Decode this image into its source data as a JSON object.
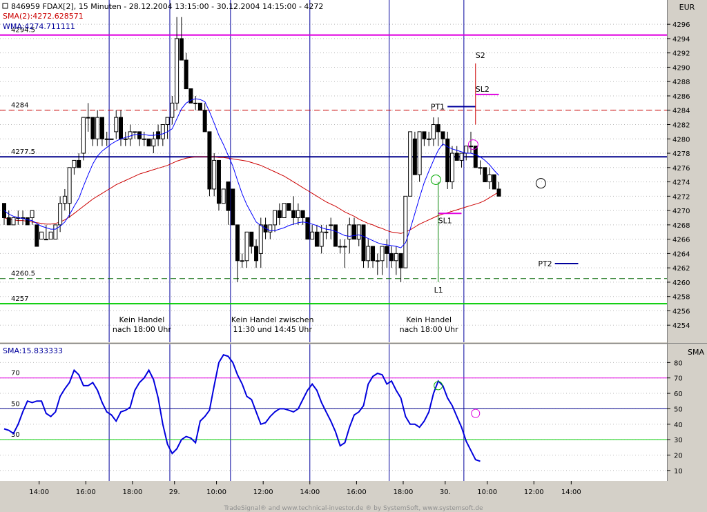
{
  "header": {
    "title": "846959  FDAX[2], 15 Minuten - 28.12.2004 13:15:00 - 30.12.2004 14:15:00 - 4272",
    "sma_label": "SMA(2):4272.628571",
    "wma_label": "WMA:4274.711111",
    "currency": "EUR"
  },
  "lower_panel": {
    "title": "SMA:15.833333",
    "axis_label": "SMA"
  },
  "footer": {
    "credit": "TradeSignal® and www.technical-investor.de ® by SystemSoft, www.systemsoft.de"
  },
  "colors": {
    "candle_up": "#ffffff",
    "candle_down": "#000000",
    "wma": "#0000ff",
    "sma": "#cc0000",
    "magenta": "#e000e0",
    "blue_level": "#00008b",
    "green_level": "#00cc00",
    "vline": "#00009c"
  },
  "chart_data": [
    {
      "type": "candlestick",
      "ylim": [
        4252,
        4299
      ],
      "y_ticks": [
        4254,
        4256,
        4258,
        4260,
        4262,
        4264,
        4266,
        4268,
        4270,
        4272,
        4274,
        4276,
        4278,
        4280,
        4282,
        4284,
        4286,
        4288,
        4290,
        4292,
        4294,
        4296
      ],
      "x_tick_labels": [
        "14:00",
        "16:00",
        "18:00",
        "29.",
        "10:00",
        "12:00",
        "14:00",
        "16:00",
        "18:00",
        "30.",
        "10:00",
        "12:00",
        "14:00"
      ],
      "candles": [
        [
          4271,
          4271,
          4268,
          4269
        ],
        [
          4269,
          4270,
          4268,
          4268
        ],
        [
          4268,
          4269,
          4268,
          4269
        ],
        [
          4269,
          4270,
          4268,
          4269
        ],
        [
          4269,
          4270,
          4268,
          4269
        ],
        [
          4269,
          4269,
          4268,
          4268
        ],
        [
          4269,
          4270,
          4268,
          4270
        ],
        [
          4268,
          4268,
          4265,
          4265
        ],
        [
          4266,
          4267,
          4266,
          4267
        ],
        [
          4266,
          4268,
          4266,
          4266
        ],
        [
          4266,
          4267,
          4266,
          4267
        ],
        [
          4266,
          4268,
          4266,
          4268
        ],
        [
          4268,
          4272,
          4267,
          4271
        ],
        [
          4271,
          4273,
          4270,
          4272
        ],
        [
          4271,
          4274,
          4269,
          4276
        ],
        [
          4276,
          4276,
          4275,
          4277
        ],
        [
          4277,
          4278,
          4276,
          4276
        ],
        [
          4278,
          4283,
          4277,
          4283
        ],
        [
          4283,
          4285,
          4281,
          4283
        ],
        [
          4283,
          4283,
          4279,
          4280
        ],
        [
          4280,
          4284,
          4279,
          4283
        ],
        [
          4283,
          4283,
          4279,
          4280
        ],
        [
          4280,
          4281,
          4279,
          4280
        ],
        [
          4280,
          4280,
          4280,
          4280
        ],
        [
          4281,
          4284,
          4280,
          4283
        ],
        [
          4283,
          4284,
          4279,
          4280
        ],
        [
          4280,
          4281,
          4279,
          4280
        ],
        [
          4280,
          4282,
          4279,
          4281
        ],
        [
          4281,
          4281,
          4280,
          4281
        ],
        [
          4281,
          4281,
          4279,
          4280
        ],
        [
          4280,
          4281,
          4279,
          4280
        ],
        [
          4280,
          4280,
          4279,
          4279
        ],
        [
          4279,
          4281,
          4278,
          4280
        ],
        [
          4281,
          4282,
          4279,
          4280
        ],
        [
          4280,
          4282,
          4279,
          4282
        ],
        [
          4282,
          4283,
          4280,
          4283
        ],
        [
          4283,
          4286,
          4282,
          4285
        ],
        [
          4285,
          4297,
          4284,
          4294
        ],
        [
          4294,
          4297,
          4291,
          4291
        ],
        [
          4291,
          4292,
          4287,
          4287
        ],
        [
          4287,
          4287,
          4285,
          4285
        ],
        [
          4285,
          4286,
          4284,
          4285
        ],
        [
          4285,
          4285,
          4284,
          4284
        ],
        [
          4284,
          4285,
          4281,
          4281
        ],
        [
          4281,
          4281,
          4272,
          4273
        ],
        [
          4273,
          4278,
          4272,
          4277
        ],
        [
          4277,
          4277,
          4270,
          4271
        ],
        [
          4271,
          4273,
          4271,
          4273
        ],
        [
          4274,
          4274,
          4268,
          4270
        ],
        [
          4273,
          4273,
          4268,
          4268
        ],
        [
          4268,
          4268,
          4260,
          4263
        ],
        [
          4263,
          4264,
          4262,
          4263
        ],
        [
          4263,
          4267,
          4262,
          4267
        ],
        [
          4267,
          4267,
          4264,
          4265
        ],
        [
          4265,
          4266,
          4262,
          4263
        ],
        [
          4264,
          4269,
          4262,
          4268
        ],
        [
          4268,
          4269,
          4266,
          4267
        ],
        [
          4267,
          4268,
          4266,
          4268
        ],
        [
          4268,
          4270,
          4267,
          4270
        ],
        [
          4270,
          4271,
          4268,
          4269
        ],
        [
          4269,
          4271,
          4269,
          4271
        ],
        [
          4271,
          4271,
          4270,
          4270
        ],
        [
          4270,
          4272,
          4268,
          4269
        ],
        [
          4269,
          4271,
          4268,
          4270
        ],
        [
          4270,
          4270,
          4268,
          4269
        ],
        [
          4269,
          4269,
          4266,
          4266
        ],
        [
          4266,
          4268,
          4266,
          4267
        ],
        [
          4267,
          4268,
          4265,
          4265
        ],
        [
          4265,
          4268,
          4264,
          4267
        ],
        [
          4267,
          4268,
          4266,
          4267
        ],
        [
          4268,
          4269,
          4266,
          4268
        ],
        [
          4268,
          4268,
          4265,
          4265
        ],
        [
          4265,
          4266,
          4264,
          4265
        ],
        [
          4265,
          4266,
          4262,
          4265
        ],
        [
          4266,
          4269,
          4264,
          4268
        ],
        [
          4268,
          4269,
          4266,
          4266
        ],
        [
          4266,
          4268,
          4265,
          4268
        ],
        [
          4268,
          4268,
          4262,
          4263
        ],
        [
          4263,
          4266,
          4262,
          4265
        ],
        [
          4265,
          4265,
          4262,
          4263
        ],
        [
          4263,
          4264,
          4261,
          4263
        ],
        [
          4263,
          4265,
          4261,
          4265
        ],
        [
          4265,
          4266,
          4262,
          4264
        ],
        [
          4264,
          4265,
          4262,
          4263
        ],
        [
          4263,
          4265,
          4261,
          4264
        ],
        [
          4264,
          4264,
          4260,
          4262
        ],
        [
          4262,
          4272,
          4262,
          4272
        ],
        [
          4272,
          4281,
          4272,
          4281
        ],
        [
          4280,
          4281,
          4275,
          4275
        ],
        [
          4275,
          4281,
          4274,
          4281
        ],
        [
          4281,
          4281,
          4279,
          4280
        ],
        [
          4280,
          4281,
          4279,
          4280
        ],
        [
          4280,
          4283,
          4279,
          4282
        ],
        [
          4282,
          4283,
          4279,
          4281
        ],
        [
          4281,
          4281,
          4279,
          4280
        ],
        [
          4280,
          4281,
          4273,
          4274
        ],
        [
          4274,
          4279,
          4273,
          4278
        ],
        [
          4278,
          4279,
          4277,
          4277
        ],
        [
          4277,
          4278,
          4276,
          4278
        ],
        [
          4278,
          4279,
          4277,
          4279
        ],
        [
          4279,
          4281,
          4278,
          4279
        ],
        [
          4279,
          4279,
          4276,
          4276
        ],
        [
          4276,
          4277,
          4275,
          4276
        ],
        [
          4276,
          4276,
          4274,
          4274
        ],
        [
          4274,
          4276,
          4273,
          4275
        ],
        [
          4275,
          4275,
          4273,
          4273
        ],
        [
          4273,
          4274,
          4272,
          4272
        ]
      ],
      "wma": [
        4270,
        4269.5,
        4269.2,
        4269,
        4268.9,
        4268.7,
        4268.6,
        4268.2,
        4267.8,
        4267.6,
        4267.4,
        4267.4,
        4267.8,
        4268.4,
        4269.4,
        4270.6,
        4271.7,
        4273.4,
        4275,
        4276.5,
        4277.6,
        4278.3,
        4278.8,
        4279.3,
        4279.7,
        4280,
        4280.2,
        4280.4,
        4280.6,
        4280.6,
        4280.6,
        4280.5,
        4280.5,
        4280.6,
        4280.7,
        4281,
        4281.4,
        4282.8,
        4284.2,
        4285,
        4285.4,
        4285.6,
        4285.5,
        4285.2,
        4283.8,
        4282.2,
        4280.5,
        4279.2,
        4277.7,
        4276.2,
        4274.2,
        4272.3,
        4270.8,
        4269.6,
        4268.4,
        4267.9,
        4267.5,
        4267.2,
        4267.2,
        4267.4,
        4267.6,
        4267.9,
        4268.1,
        4268.3,
        4268.4,
        4268.3,
        4268.1,
        4267.9,
        4267.6,
        4267.4,
        4267.3,
        4267.1,
        4266.8,
        4266.5,
        4266.4,
        4266.5,
        4266.6,
        4266.4,
        4266.1,
        4265.8,
        4265.5,
        4265.3,
        4265.2,
        4265.1,
        4265,
        4264.8,
        4265.5,
        4267.4,
        4269.6,
        4271.8,
        4273.9,
        4275.5,
        4277,
        4278.4,
        4279.3,
        4278.9,
        4278.6,
        4278.4,
        4278.2,
        4278,
        4278,
        4277.8,
        4277.5,
        4277,
        4276.4,
        4275.6,
        4274.9
      ],
      "sma": [
        4269,
        4268.8,
        4268.7,
        4268.6,
        4268.6,
        4268.5,
        4268.4,
        4268.3,
        4268.2,
        4268.1,
        4268.1,
        4268.2,
        4268.4,
        4268.7,
        4269.1,
        4269.6,
        4270.1,
        4270.6,
        4271.1,
        4271.6,
        4272,
        4272.4,
        4272.8,
        4273.2,
        4273.6,
        4273.9,
        4274.2,
        4274.5,
        4274.8,
        4275.1,
        4275.3,
        4275.5,
        4275.7,
        4275.9,
        4276.1,
        4276.3,
        4276.6,
        4276.9,
        4277.1,
        4277.3,
        4277.4,
        4277.5,
        4277.5,
        4277.5,
        4277.5,
        4277.5,
        4277.4,
        4277.4,
        4277.3,
        4277.2,
        4277.1,
        4277,
        4276.9,
        4276.7,
        4276.5,
        4276.3,
        4276,
        4275.7,
        4275.4,
        4275.1,
        4274.8,
        4274.4,
        4274,
        4273.6,
        4273.2,
        4272.8,
        4272.4,
        4272,
        4271.6,
        4271.2,
        4270.9,
        4270.6,
        4270.2,
        4269.8,
        4269.5,
        4269.2,
        4268.8,
        4268.5,
        4268.2,
        4268,
        4267.7,
        4267.5,
        4267.2,
        4267,
        4266.9,
        4266.8,
        4267,
        4267.3,
        4267.7,
        4268.1,
        4268.4,
        4268.7,
        4269,
        4269.3,
        4269.5,
        4269.7,
        4269.9,
        4270.1,
        4270.3,
        4270.5,
        4270.7,
        4270.9,
        4271.1,
        4271.4,
        4271.8,
        4272.2,
        4272.6
      ],
      "levels": [
        {
          "label": "4294.5",
          "value": 4294.5,
          "color": "#e000e0",
          "style": "solid"
        },
        {
          "label": "4284",
          "value": 4284,
          "color": "#cc0000",
          "style": "dashed"
        },
        {
          "label": "4277.5",
          "value": 4277.5,
          "color": "#00008b",
          "style": "solid"
        },
        {
          "label": "4260.5",
          "value": 4260.5,
          "color": "#006600",
          "style": "dashed"
        },
        {
          "label": "4257",
          "value": 4257,
          "color": "#00cc00",
          "style": "solid"
        }
      ],
      "session_lines": [
        23,
        36,
        49,
        66,
        83,
        99
      ],
      "annotations": [
        {
          "text": "Kein Handel",
          "text2": "nach 18:00 Uhr",
          "index": 29.5
        },
        {
          "text": "Kein Handel zwischen",
          "text2": "11:30 und 14:45 Uhr",
          "index": 57.5
        },
        {
          "text": "Kein Handel",
          "text2": "nach 18:00 Uhr",
          "index": 91
        }
      ],
      "trade_marks": [
        {
          "label": "PT1",
          "value": 4284.5,
          "x_from": 95,
          "x_to": 101,
          "color": "#00009c",
          "label_at": "left"
        },
        {
          "label": "S2",
          "value": 4291.5,
          "index": 101,
          "color": "#cc0000"
        },
        {
          "label": "SL2",
          "value": 4286.2,
          "x_from": 101,
          "x_to": 106,
          "color": "#e000e0",
          "label_at": "top"
        },
        {
          "label": "SL1",
          "value": 4269.6,
          "x_from": 93,
          "x_to": 98,
          "color": "#e000e0",
          "label_at": "below"
        },
        {
          "label": "L1",
          "value": 4260,
          "index": 93,
          "color": "#008000"
        },
        {
          "label": "PT2",
          "value": 4262.6,
          "x_from": 118,
          "x_to": 123,
          "color": "#00009c",
          "label_at": "left"
        }
      ],
      "circles": [
        {
          "index": 92.5,
          "value": 4274.3,
          "color": "#00aa00"
        },
        {
          "index": 100.5,
          "value": 4279.2,
          "color": "#e000e0"
        },
        {
          "index": 115,
          "value": 4273.8,
          "color": "#000000"
        }
      ]
    },
    {
      "type": "line",
      "name": "SMA",
      "ylim": [
        5,
        90
      ],
      "y_ticks": [
        10,
        20,
        30,
        40,
        50,
        60,
        70,
        80
      ],
      "levels": [
        {
          "label": "70",
          "value": 70,
          "color": "#e000e0"
        },
        {
          "label": "50",
          "value": 50,
          "color": "#00008b"
        },
        {
          "label": "30",
          "value": 30,
          "color": "#00cc00"
        }
      ],
      "values": [
        37,
        36,
        34,
        40,
        48,
        55,
        54,
        55,
        55,
        47,
        45,
        48,
        58,
        63,
        67,
        75,
        72,
        65,
        65,
        67,
        62,
        54,
        48,
        46,
        42,
        48,
        49,
        51,
        62,
        67,
        70,
        75,
        69,
        57,
        40,
        27,
        21,
        24,
        30,
        32,
        31,
        28,
        42,
        45,
        49,
        65,
        80,
        85,
        84,
        80,
        72,
        66,
        58,
        56,
        48,
        40,
        41,
        45,
        48,
        50,
        50,
        49,
        48,
        50,
        56,
        62,
        66,
        62,
        54,
        48,
        42,
        35,
        26,
        28,
        38,
        46,
        48,
        52,
        66,
        71,
        73,
        72,
        66,
        68,
        62,
        57,
        45,
        40,
        40,
        38,
        42,
        48,
        60,
        68,
        65,
        57,
        52,
        45,
        38,
        29,
        23,
        17,
        16
      ],
      "circles": [
        {
          "index": 93,
          "value": 65,
          "color": "#00aa00"
        },
        {
          "index": 101,
          "value": 47,
          "color": "#e000e0"
        }
      ]
    }
  ]
}
